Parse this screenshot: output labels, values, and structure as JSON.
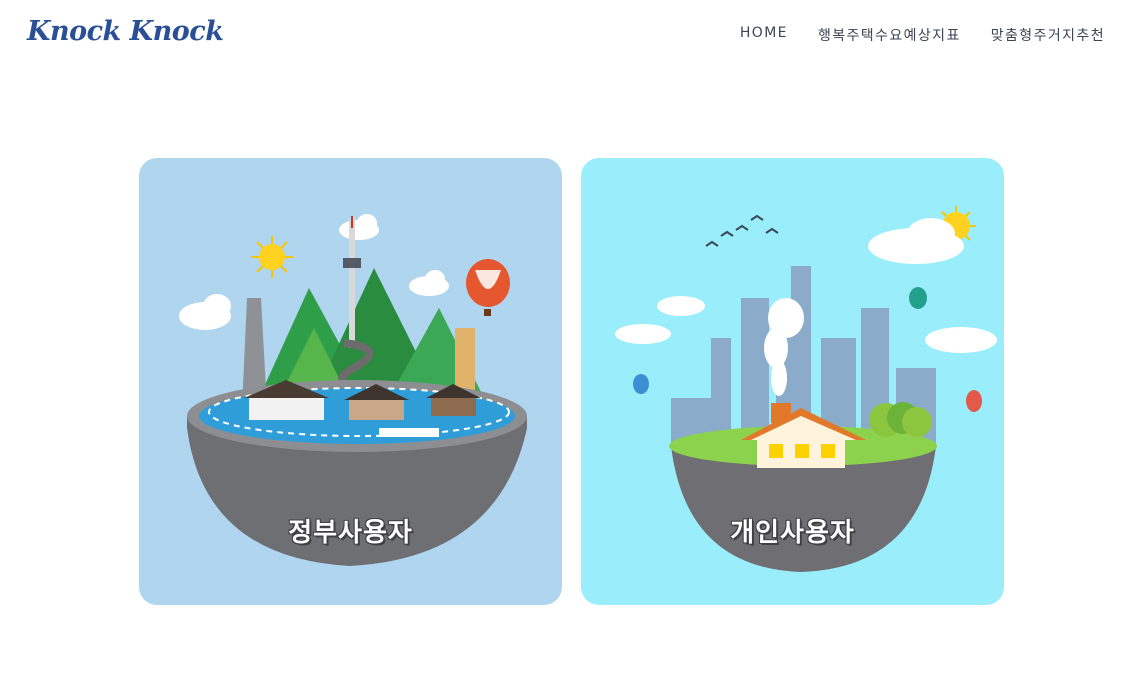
{
  "header": {
    "logo": "Knock Knock",
    "nav": [
      {
        "label": "HOME"
      },
      {
        "label": "행복주택수요예상지표"
      },
      {
        "label": "맞춤형주거지추천"
      }
    ]
  },
  "cards": [
    {
      "label": "정부사용자"
    },
    {
      "label": "개인사용자"
    }
  ]
}
